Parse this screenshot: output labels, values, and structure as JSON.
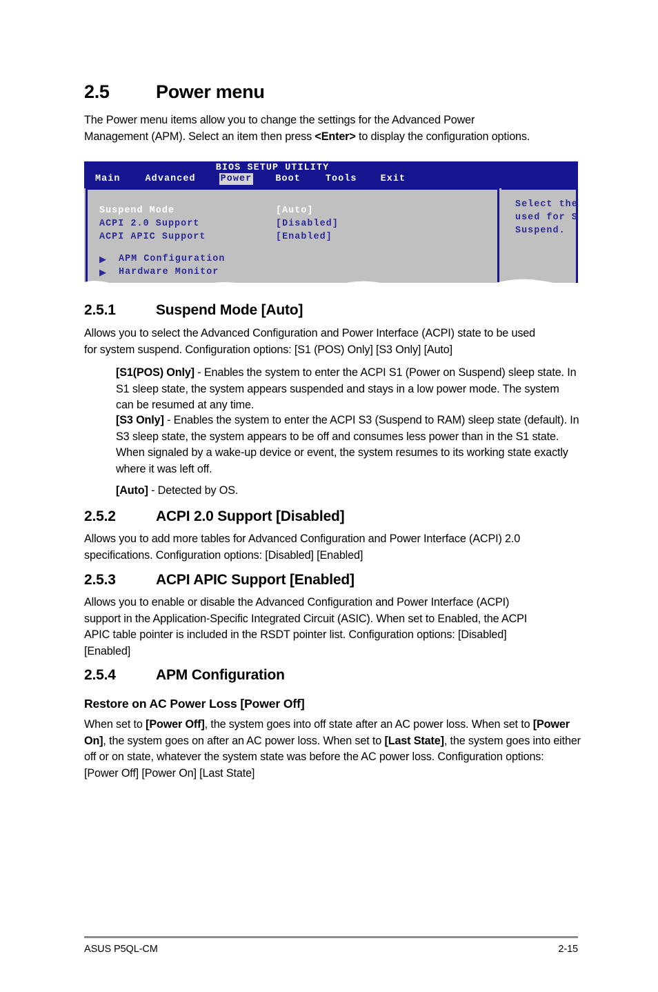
{
  "section": {
    "number": "2.5",
    "title": "Power menu",
    "intro_a": "The Power menu items allow you to change the settings for the Advanced Power",
    "intro_b_pre": "Management (APM). Select an item then press ",
    "intro_b_bold": "<Enter>",
    "intro_b_post": " to display the configuration options."
  },
  "bios": {
    "title": "BIOS SETUP UTILITY",
    "tabs": [
      {
        "label": "Main",
        "active": false
      },
      {
        "label": "Advanced",
        "active": false
      },
      {
        "label": "Power",
        "active": true
      },
      {
        "label": "Boot",
        "active": false
      },
      {
        "label": "Tools",
        "active": false
      },
      {
        "label": "Exit",
        "active": false
      }
    ],
    "items": [
      {
        "label": "Suspend Mode",
        "value": "[Auto]",
        "selected": true
      },
      {
        "label": "ACPI 2.0 Support",
        "value": "[Disabled]",
        "selected": false
      },
      {
        "label": "ACPI APIC Support",
        "value": "[Enabled]",
        "selected": false
      }
    ],
    "submenus": [
      {
        "arrow": "right-triangle-icon",
        "label": "APM Configuration"
      },
      {
        "arrow": "right-triangle-icon",
        "label": "Hardware Monitor"
      }
    ],
    "help": [
      "Select the ACPI state",
      "used for System",
      "Suspend."
    ],
    "colors": {
      "header_bg": "#151590",
      "body_bg": "#c0c0c0",
      "text": "#2a2a96",
      "selected_text": "#ffffff",
      "active_tab_bg": "#d4d4d4"
    }
  },
  "s251": {
    "number": "2.5.1",
    "title": "Suspend Mode [Auto]",
    "body_l1": "Allows you to select the Advanced Configuration and Power Interface (ACPI) state to be used",
    "body_l2": "for system suspend. Configuration options: [S1 (POS) Only] [S3 Only] [Auto]",
    "b1_bold": "[S1(POS) Only]",
    "b1_rest": " - Enables the system to enter the ACPI S1 (Power on Suspend) sleep state. In S1 sleep state, the system appears suspended and stays in a low power mode. The system can be resumed at any time.",
    "b2_bold": "[S3 Only]",
    "b2_rest": " - Enables the system to enter the ACPI S3 (Suspend to RAM) sleep state (default). In S3 sleep state, the system appears to be off and consumes less power than in the S1 state. When signaled by a wake-up device or event, the system resumes to its working state exactly where it was left off.",
    "b3_bold": "[Auto]",
    "b3_rest": " - Detected by OS."
  },
  "s252": {
    "number": "2.5.2",
    "title": "ACPI 2.0 Support [Disabled]",
    "body_l1": "Allows you to add more tables for Advanced Configuration and Power Interface (ACPI) 2.0",
    "body_l2": "specifications. Configuration options: [Disabled] [Enabled]"
  },
  "s253": {
    "number": "2.5.3",
    "title": "ACPI APIC Support [Enabled]",
    "body_l1": "Allows you to enable or disable the Advanced Configuration and Power Interface (ACPI)",
    "body_l2": "support in the Application-Specific Integrated Circuit (ASIC). When set to Enabled, the ACPI",
    "body_l3": "APIC table pointer is included in the RSDT pointer list. Configuration options: [Disabled]",
    "body_l4": "[Enabled]"
  },
  "s254": {
    "number": "2.5.4",
    "title": "APM Configuration",
    "sub_title": "Restore on AC Power Loss [Power Off]",
    "p_1": "When set to ",
    "p_1b": "[Power Off]",
    "p_2": ", the system goes into off state after an AC power loss. When set to ",
    "p_2b": "[Power On]",
    "p_3": ", the system goes on after an AC power loss. When set to ",
    "p_3b": "[Last State]",
    "p_4": ", the system goes into either off or on state, whatever the system state was before the AC power loss. Configuration options: [Power Off] [Power On] [Last State]"
  },
  "footer": {
    "left": "ASUS P5QL-CM",
    "right": "2-15"
  }
}
